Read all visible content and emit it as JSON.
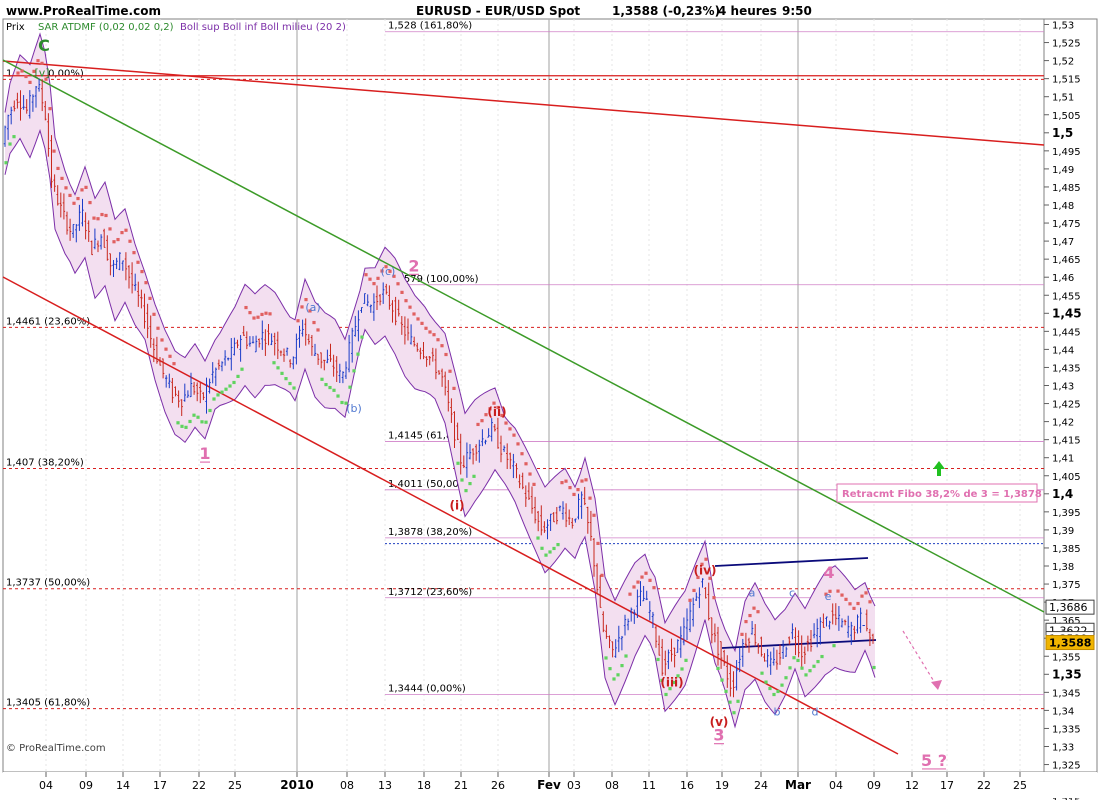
{
  "header": {
    "site": "www.ProRealTime.com",
    "title": "EURUSD - EUR/USD Spot",
    "price": "1,3588 (-0,23%)",
    "period": "4 heures",
    "time": "9:50"
  },
  "legend": {
    "prix": "Prix",
    "sar": "SAR ATDMF (0,02 0,02 0,2)",
    "boll": "Boll sup Boll inf Boll milieu (20 2)"
  },
  "footer": {
    "copyright": "© ProRealTime.com"
  },
  "colors": {
    "background": "#ffffff",
    "plot_border": "#808080",
    "grid": "#c8c8c8",
    "red_line": "#d81e1e",
    "green_line": "#3c9b28",
    "boll_fill": "#f3dff0",
    "boll_line": "#7c2fa8",
    "sar_green": "#5fd35f",
    "sar_red": "#e06060",
    "candle_blue": "#1a3cc8",
    "candle_red": "#c8281e",
    "wave_pink": "#e070b0",
    "wave_red": "#c81e1e",
    "wave_blue": "#5078d0",
    "wave_green": "#2d8b2d",
    "channel_navy": "#0a0a7a",
    "price_tag": "#f0b400"
  },
  "chart_data": {
    "type": "candlestick",
    "instrument": "EURUSD - EUR/USD Spot",
    "timeframe": "4 heures",
    "ylim": [
      1.3125,
      1.5325
    ],
    "y_ticks": [
      "1,53",
      "1,525",
      "1,52",
      "1,515",
      "1,51",
      "1,505",
      "1,5",
      "1,495",
      "1,49",
      "1,485",
      "1,48",
      "1,475",
      "1,47",
      "1,465",
      "1,46",
      "1,455",
      "1,45",
      "1,445",
      "1,44",
      "1,435",
      "1,43",
      "1,425",
      "1,42",
      "1,415",
      "1,41",
      "1,405",
      "1,4",
      "1,395",
      "1,39",
      "1,385",
      "1,38",
      "1,375",
      "1,37",
      "1,365",
      "1,36",
      "1,355",
      "1,35",
      "1,345",
      "1,34",
      "1,335",
      "1,33",
      "1,325",
      "1,32",
      "1,315"
    ],
    "y_ticks_bold": [
      "1,5",
      "1,45",
      "1,4",
      "1,35"
    ],
    "x_ticks": [
      {
        "label": "04",
        "bold": false
      },
      {
        "label": "09",
        "bold": false
      },
      {
        "label": "14",
        "bold": false
      },
      {
        "label": "17",
        "bold": false
      },
      {
        "label": "22",
        "bold": false
      },
      {
        "label": "25",
        "bold": false
      },
      {
        "label": "2010",
        "bold": true
      },
      {
        "label": "08",
        "bold": false
      },
      {
        "label": "13",
        "bold": false
      },
      {
        "label": "18",
        "bold": false
      },
      {
        "label": "21",
        "bold": false
      },
      {
        "label": "26",
        "bold": false
      },
      {
        "label": "Fev",
        "bold": true
      },
      {
        "label": "03",
        "bold": false
      },
      {
        "label": "08",
        "bold": false
      },
      {
        "label": "11",
        "bold": false
      },
      {
        "label": "16",
        "bold": false
      },
      {
        "label": "19",
        "bold": false
      },
      {
        "label": "24",
        "bold": false
      },
      {
        "label": "Mar",
        "bold": true
      },
      {
        "label": "04",
        "bold": false
      },
      {
        "label": "09",
        "bold": false
      },
      {
        "label": "12",
        "bold": false
      },
      {
        "label": "17",
        "bold": false
      },
      {
        "label": "22",
        "bold": false
      },
      {
        "label": "25",
        "bold": false
      }
    ],
    "price_series": {
      "name": "EURUSD",
      "points": [
        [
          0,
          1.49
        ],
        [
          10,
          1.504
        ],
        [
          20,
          1.51
        ],
        [
          30,
          1.506
        ],
        [
          40,
          1.514
        ],
        [
          48,
          1.506
        ],
        [
          55,
          1.486
        ],
        [
          65,
          1.478
        ],
        [
          75,
          1.472
        ],
        [
          85,
          1.478
        ],
        [
          95,
          1.468
        ],
        [
          105,
          1.472
        ],
        [
          115,
          1.462
        ],
        [
          125,
          1.466
        ],
        [
          135,
          1.458
        ],
        [
          145,
          1.452
        ],
        [
          155,
          1.442
        ],
        [
          165,
          1.434
        ],
        [
          175,
          1.428
        ],
        [
          185,
          1.426
        ],
        [
          195,
          1.43
        ],
        [
          205,
          1.426
        ],
        [
          215,
          1.433
        ],
        [
          225,
          1.436
        ],
        [
          235,
          1.439
        ],
        [
          245,
          1.444
        ],
        [
          255,
          1.441
        ],
        [
          265,
          1.444
        ],
        [
          275,
          1.443
        ],
        [
          285,
          1.44
        ],
        [
          295,
          1.437
        ],
        [
          305,
          1.447
        ],
        [
          315,
          1.44
        ],
        [
          325,
          1.437
        ],
        [
          335,
          1.436
        ],
        [
          345,
          1.432
        ],
        [
          355,
          1.443
        ],
        [
          365,
          1.454
        ],
        [
          375,
          1.452
        ],
        [
          385,
          1.456
        ],
        [
          395,
          1.452
        ],
        [
          405,
          1.446
        ],
        [
          415,
          1.442
        ],
        [
          425,
          1.44
        ],
        [
          435,
          1.437
        ],
        [
          445,
          1.432
        ],
        [
          455,
          1.42
        ],
        [
          465,
          1.408
        ],
        [
          475,
          1.412
        ],
        [
          485,
          1.415
        ],
        [
          495,
          1.418
        ],
        [
          505,
          1.412
        ],
        [
          515,
          1.408
        ],
        [
          525,
          1.402
        ],
        [
          535,
          1.396
        ],
        [
          545,
          1.39
        ],
        [
          555,
          1.393
        ],
        [
          565,
          1.396
        ],
        [
          575,
          1.392
        ],
        [
          585,
          1.399
        ],
        [
          595,
          1.386
        ],
        [
          605,
          1.363
        ],
        [
          615,
          1.356
        ],
        [
          625,
          1.362
        ],
        [
          635,
          1.368
        ],
        [
          645,
          1.372
        ],
        [
          655,
          1.366
        ],
        [
          665,
          1.352
        ],
        [
          675,
          1.356
        ],
        [
          685,
          1.36
        ],
        [
          695,
          1.368
        ],
        [
          705,
          1.376
        ],
        [
          715,
          1.362
        ],
        [
          725,
          1.354
        ],
        [
          735,
          1.346
        ],
        [
          745,
          1.358
        ],
        [
          755,
          1.362
        ],
        [
          765,
          1.356
        ],
        [
          775,
          1.352
        ],
        [
          785,
          1.356
        ],
        [
          795,
          1.362
        ],
        [
          805,
          1.356
        ],
        [
          815,
          1.36
        ],
        [
          825,
          1.364
        ],
        [
          835,
          1.366
        ],
        [
          845,
          1.364
        ],
        [
          855,
          1.362
        ],
        [
          865,
          1.366
        ],
        [
          875,
          1.359
        ]
      ]
    },
    "fibonacci_levels": [
      {
        "label": "1,528 (161,80%)",
        "value": 1.528,
        "line": "thin"
      },
      {
        "label": "1,5148 (0,00%)",
        "value": 1.5148,
        "line": "dashed"
      },
      {
        "label": "1,4579 (100,00%)",
        "value": 1.4579,
        "line": "thin"
      },
      {
        "label": "1,4461 (23,60%)",
        "value": 1.4461,
        "line": "dashed"
      },
      {
        "label": "1,4145 (61,80%)",
        "value": 1.4145,
        "line": "thin"
      },
      {
        "label": "1,407 (38,20%)",
        "value": 1.407,
        "line": "dashed"
      },
      {
        "label": "1,4011 (50,00%)",
        "value": 1.4011,
        "line": "thin"
      },
      {
        "label": "1,3878 (38,20%)",
        "value": 1.3878,
        "line": "thin"
      },
      {
        "label": "1,3737 (50,00%)",
        "value": 1.3737,
        "line": "dashed"
      },
      {
        "label": "1,3712 (23,60%)",
        "value": 1.3712,
        "line": "thin"
      },
      {
        "label": "1,3444 (0,00%)",
        "value": 1.3444,
        "line": "thin"
      },
      {
        "label": "1,3405 (61,80%)",
        "value": 1.3405,
        "line": "dashed"
      }
    ],
    "wave_labels": [
      {
        "text": "C",
        "value": 1.524,
        "color": "green"
      },
      {
        "text": "[v]",
        "value": 1.517,
        "color": "green"
      },
      {
        "text": "(c)",
        "value": 1.462,
        "color": "blue"
      },
      {
        "text": "2",
        "value": 1.463,
        "color": "pink"
      },
      {
        "text": "(a)",
        "value": 1.452,
        "color": "blue"
      },
      {
        "text": "(b)",
        "value": 1.424,
        "color": "blue"
      },
      {
        "text": "1",
        "value": 1.411,
        "color": "pink"
      },
      {
        "text": "(ii)",
        "value": 1.423,
        "color": "red"
      },
      {
        "text": "(i)",
        "value": 1.397,
        "color": "red"
      },
      {
        "text": "(iv)",
        "value": 1.379,
        "color": "red"
      },
      {
        "text": "4",
        "value": 1.378,
        "color": "pink"
      },
      {
        "text": "a",
        "value": 1.373,
        "color": "blue"
      },
      {
        "text": "c",
        "value": 1.373,
        "color": "blue"
      },
      {
        "text": "e",
        "value": 1.372,
        "color": "blue"
      },
      {
        "text": "(iii)",
        "value": 1.348,
        "color": "red"
      },
      {
        "text": "b",
        "value": 1.34,
        "color": "blue"
      },
      {
        "text": "d",
        "value": 1.34,
        "color": "blue"
      },
      {
        "text": "(v)",
        "value": 1.337,
        "color": "red"
      },
      {
        "text": "3",
        "value": 1.333,
        "color": "pink"
      },
      {
        "text": "5 ?",
        "value": 1.326,
        "color": "pink"
      }
    ],
    "annotation": "Retracmt Fibo 38,2% de 3 = 1,3878",
    "price_tags": [
      {
        "label": "1,3686",
        "value": 1.3686,
        "style": "white"
      },
      {
        "label": "1,3622",
        "value": 1.3622,
        "style": "white"
      },
      {
        "label": "1,3599",
        "value": 1.3599,
        "style": "white"
      },
      {
        "label": "1,3588",
        "value": 1.3588,
        "style": "highlight"
      }
    ]
  }
}
